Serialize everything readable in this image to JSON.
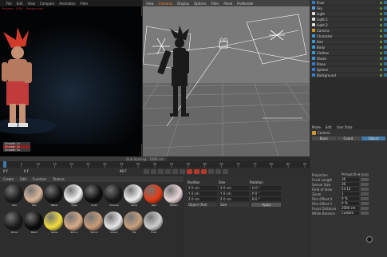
{
  "render_view": {
    "menu": [
      "File",
      "Edit",
      "View",
      "Compare",
      "Animation",
      "Filter"
    ],
    "info_text": "Progress: 100%  ·  Render time",
    "hud": [
      "Smooth 1x",
      "Smooth 2x",
      "Smooth 3x"
    ]
  },
  "viewport": {
    "menu": [
      "View",
      "Cameras",
      "Display",
      "Options",
      "Filter",
      "Panel",
      "ProRender"
    ],
    "active_menu_index": 1,
    "status_text": "Grid Spacing : 1000 cm"
  },
  "object_manager": {
    "rows": [
      {
        "name": "Floor",
        "color": "#2f7fd8"
      },
      {
        "name": "Sky",
        "color": "#5aa0e0"
      },
      {
        "name": "Light",
        "color": "#e0e0e0"
      },
      {
        "name": "Light.1",
        "color": "#e0e0e0"
      },
      {
        "name": "Light.2",
        "color": "#e0e0e0"
      },
      {
        "name": "Camera",
        "color": "#d09a2a"
      },
      {
        "name": "Character",
        "color": "#3b9ad8"
      },
      {
        "name": "Hair",
        "color": "#3b9ad8"
      },
      {
        "name": "Body",
        "color": "#3b9ad8"
      },
      {
        "name": "Clothes",
        "color": "#3b9ad8"
      },
      {
        "name": "Shoes",
        "color": "#3b9ad8"
      },
      {
        "name": "Plane",
        "color": "#2f7fd8"
      },
      {
        "name": "Sphere",
        "color": "#2f7fd8"
      },
      {
        "name": "Background",
        "color": "#2f7fd8"
      }
    ]
  },
  "attribute_manager": {
    "header": [
      "Mode",
      "Edit",
      "User Data"
    ],
    "tabs": [
      "Basic",
      "Coord.",
      "Object"
    ],
    "selected_tab": 2,
    "rows": [
      {
        "label": "Projection",
        "value": "Perspective"
      },
      {
        "label": "Focal Length",
        "value": "36"
      },
      {
        "label": "Sensor Size",
        "value": "36"
      },
      {
        "label": "Field of View",
        "value": "53.13"
      },
      {
        "label": "Zoom",
        "value": "1"
      },
      {
        "label": "Film Offset X",
        "value": "0 %"
      },
      {
        "label": "Film Offset Y",
        "value": "0 %"
      },
      {
        "label": "Focus Distance",
        "value": "2000 cm"
      },
      {
        "label": "White Balance",
        "value": "Custom"
      }
    ]
  },
  "timeline": {
    "ticks": [
      "0",
      "5",
      "10",
      "15",
      "20",
      "25",
      "30",
      "35",
      "40",
      "45",
      "50",
      "55",
      "60",
      "65",
      "70",
      "75",
      "80",
      "85",
      "90"
    ],
    "frame_start": "0 F",
    "frame_end": "90 F",
    "current_frame": "0 F"
  },
  "material_manager": {
    "menu": [
      "Create",
      "Edit",
      "Function",
      "Texture"
    ],
    "materials": [
      {
        "name": "Hair",
        "color": "#1a1a1a"
      },
      {
        "name": "Skin",
        "color": "#d8b49a"
      },
      {
        "name": "Metal",
        "color": "#111"
      },
      {
        "name": "Eyes",
        "color": "#f2f2f2"
      },
      {
        "name": "Cloth",
        "color": "#0d0d0d"
      },
      {
        "name": "Chrome",
        "color": "#1a1a1a"
      },
      {
        "name": "Lamp",
        "color": "#efefef"
      },
      {
        "name": "Red",
        "color": "#e23b16"
      },
      {
        "name": "Pattern",
        "color": "#e8d6d6"
      },
      {
        "name": "Wood",
        "color": "#1a1a1a"
      },
      {
        "name": "Black",
        "color": "#0a0a0a"
      },
      {
        "name": "Yellow",
        "color": "#f2de3c"
      },
      {
        "name": "Skin.1",
        "color": "#d8aa86"
      },
      {
        "name": "Skin.2",
        "color": "#c99c7a"
      },
      {
        "name": "Check",
        "color": "#e8e8e8"
      },
      {
        "name": "Tile",
        "color": "#c9a07e"
      },
      {
        "name": "Floor",
        "color": "#cfcfcf"
      }
    ]
  },
  "coordinate_manager": {
    "headers": [
      "Position",
      "Size",
      "Rotation"
    ],
    "rows": [
      [
        "X  0 cm",
        "X  0 cm",
        "H  0 °"
      ],
      [
        "Y  0 cm",
        "Y  0 cm",
        "P  0 °"
      ],
      [
        "Z  0 cm",
        "Z  0 cm",
        "B  0 °"
      ]
    ],
    "mode_select": "Object (Rel)",
    "size_select": "Size",
    "apply_label": "Apply"
  }
}
